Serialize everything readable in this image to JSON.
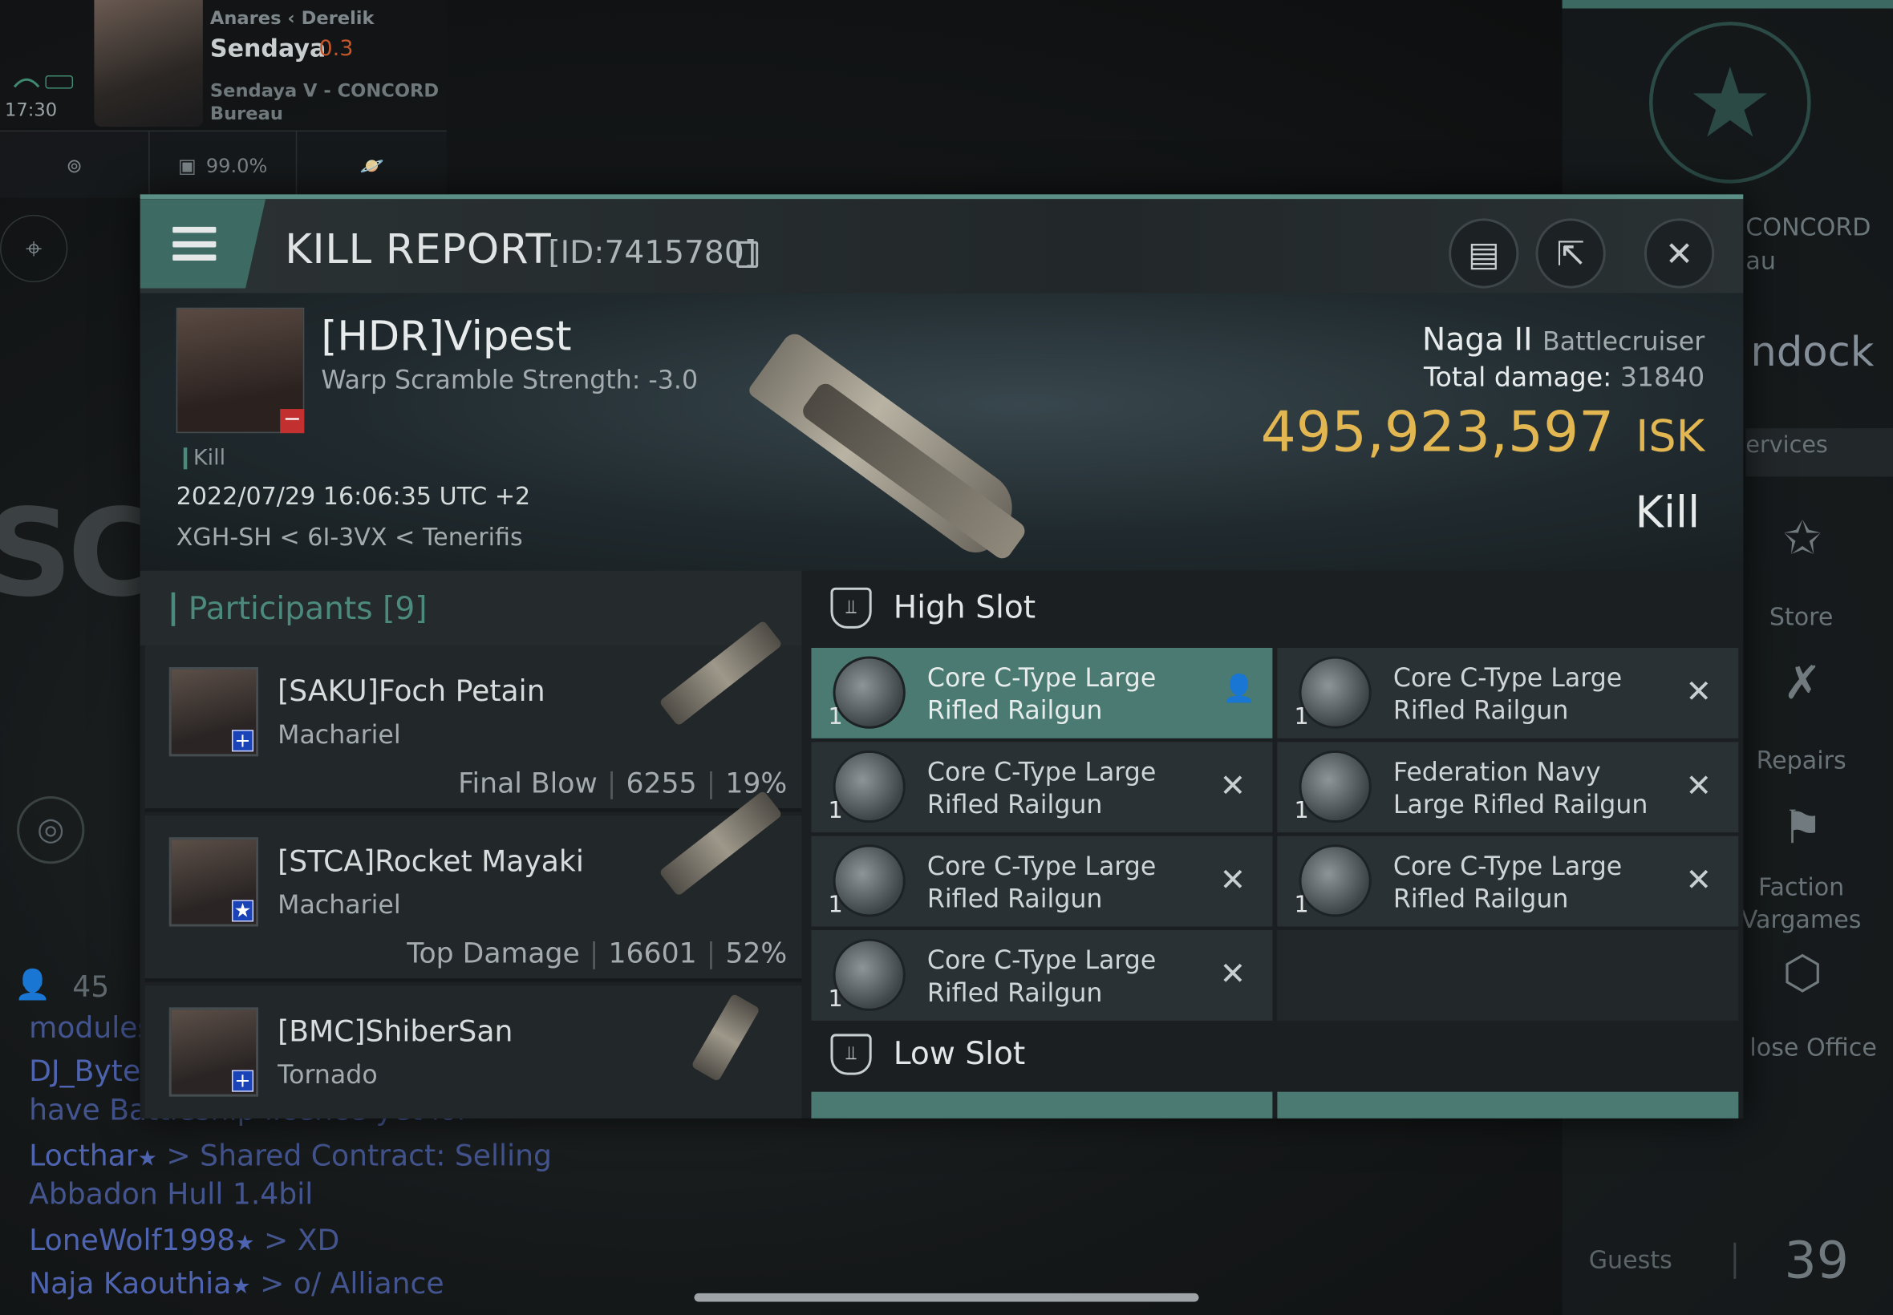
{
  "hud": {
    "time": "17:30",
    "route": "Anares  ‹ Derelik",
    "system": "Sendaya",
    "security": "0.3",
    "station": "Sendaya V - CONCORD Bureau",
    "cargo_percent": "99.0%"
  },
  "right_panel": {
    "concord_label": "CONCORD\nau",
    "undock": "ndock",
    "services": "ervices",
    "store": "Store",
    "repairs": "Repairs",
    "faction_warfare": "Faction\nVargames",
    "close_office": "lose Office",
    "guests_label": "Guests",
    "guests_count": "39"
  },
  "chat": {
    "user_count": "45",
    "lines": [
      "modules",
      "DJ_Byte",
      "have Battleship licence yet lol",
      "Locthar",
      " > Shared Contract: Selling",
      "Abbadon Hull 1.4bil",
      "LoneWolf1998",
      " > XD",
      "Naja Kaouthia",
      " > o/ Alliance"
    ]
  },
  "modal": {
    "title": "KILL REPORT",
    "id": "[ID:7415780]",
    "victim": {
      "name": "[HDR]Vipest",
      "warp": "Warp Scramble Strength: -3.0",
      "kill_label": "Kill",
      "date": "2022/07/29 16:06:35 UTC +2",
      "location": "XGH-SH < 6I-3VX < Tenerifis"
    },
    "ship": {
      "name": "Naga II",
      "class": "Battlecruiser",
      "total_damage_label": "Total damage:",
      "total_damage": "31840",
      "isk_value": "495,923,597",
      "isk_unit": "ISK",
      "kill_type": "Kill"
    },
    "participants": {
      "title": "Participants",
      "count": "[9]",
      "rows": [
        {
          "name": "[SAKU]Foch Petain",
          "ship": "Machariel",
          "role": "Final Blow",
          "damage": "6255",
          "percent": "19%",
          "badge": "+"
        },
        {
          "name": "[STCA]Rocket Mayaki",
          "ship": "Machariel",
          "role": "Top Damage",
          "damage": "16601",
          "percent": "52%",
          "badge": "★"
        },
        {
          "name": "[BMC]ShiberSan",
          "ship": "Tornado",
          "badge": "+"
        }
      ]
    },
    "high_slot": {
      "title": "High Slot",
      "modules": [
        {
          "qty": "1",
          "name": "Core C-Type Large\nRifled Railgun"
        },
        {
          "qty": "1",
          "name": "Core C-Type Large\nRifled Railgun"
        },
        {
          "qty": "1",
          "name": "Core C-Type Large\nRifled Railgun"
        },
        {
          "qty": "1",
          "name": "Federation Navy\nLarge Rifled Railgun"
        },
        {
          "qty": "1",
          "name": "Core C-Type Large\nRifled Railgun"
        },
        {
          "qty": "1",
          "name": "Core C-Type Large\nRifled Railgun"
        },
        {
          "qty": "1",
          "name": "Core C-Type Large\nRifled Railgun"
        }
      ]
    },
    "low_slot": {
      "title": "Low Slot"
    }
  }
}
